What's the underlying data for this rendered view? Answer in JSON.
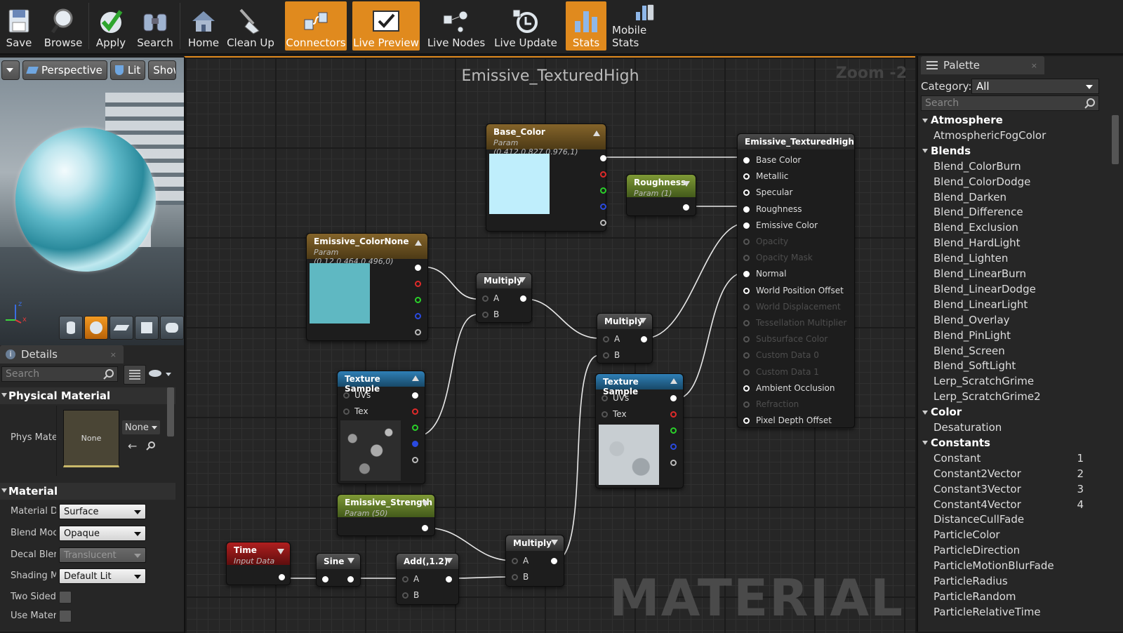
{
  "toolbar": {
    "save": "Save",
    "browse": "Browse",
    "apply": "Apply",
    "search": "Search",
    "home": "Home",
    "clean_up": "Clean Up",
    "connectors": "Connectors",
    "live_preview": "Live Preview",
    "live_nodes": "Live Nodes",
    "live_update": "Live Update",
    "stats": "Stats",
    "mobile_stats": "Mobile Stats"
  },
  "viewport": {
    "perspective": "Perspective",
    "lit": "Lit",
    "show": "Show",
    "axis_z": "z",
    "axis_x": "x"
  },
  "details": {
    "tab": "Details",
    "search_placeholder": "Search",
    "physical_material": {
      "heading": "Physical Material",
      "phys_label": "Phys Mate",
      "thumb_text": "None",
      "combo": "None"
    },
    "material": {
      "heading": "Material",
      "domain_label": "Material D",
      "domain_value": "Surface",
      "blend_label": "Blend Moc",
      "blend_value": "Opaque",
      "decal_label": "Decal Bler",
      "decal_value": "Translucent",
      "shading_label": "Shading M",
      "shading_value": "Default Lit",
      "two_sided_label": "Two Sided",
      "use_mat_label": "Use Mater"
    }
  },
  "graph": {
    "title": "Emissive_TexturedHigh",
    "zoom": "Zoom -2",
    "watermark": "MATERIAL",
    "nodes": {
      "base_color": {
        "title": "Base_Color",
        "sub": "Param (0.412,0.827,0.976,1)",
        "color": "#bfeefc"
      },
      "roughness": {
        "title": "Roughness",
        "sub": "Param (1)"
      },
      "emissive_color": {
        "title": "Emissive_ColorNone",
        "sub": "Param (0.12,0.464,0.496,0)",
        "color": "#5fb8c2"
      },
      "multiply1": {
        "title": "Multiply",
        "a": "A",
        "b": "B"
      },
      "multiply2": {
        "title": "Multiply",
        "a": "A",
        "b": "B"
      },
      "multiply3": {
        "title": "Multiply",
        "a": "A",
        "b": "B"
      },
      "tex1": {
        "title": "Texture Sample",
        "uvs": "UVs",
        "tex": "Tex"
      },
      "tex2": {
        "title": "Texture Sample",
        "uvs": "UVs",
        "tex": "Tex"
      },
      "emissive_strength": {
        "title": "Emissive_Strength",
        "sub": "Param (50)"
      },
      "time": {
        "title": "Time",
        "sub": "Input Data"
      },
      "sine": {
        "title": "Sine"
      },
      "add": {
        "title": "Add(,1.2)",
        "a": "A",
        "b": "B"
      },
      "result": {
        "title": "Emissive_TexturedHigh",
        "pins": [
          "Base Color",
          "Metallic",
          "Specular",
          "Roughness",
          "Emissive Color",
          "Opacity",
          "Opacity Mask",
          "Normal",
          "World Position Offset",
          "World Displacement",
          "Tessellation Multiplier",
          "Subsurface Color",
          "Custom Data 0",
          "Custom Data 1",
          "Ambient Occlusion",
          "Refraction",
          "Pixel Depth Offset"
        ]
      }
    }
  },
  "palette": {
    "tab": "Palette",
    "category_label": "Category:",
    "category_value": "All",
    "search_placeholder": "Search",
    "entries": [
      {
        "cat": "Atmosphere"
      },
      {
        "item": "AtmosphericFogColor"
      },
      {
        "cat": "Blends"
      },
      {
        "item": "Blend_ColorBurn"
      },
      {
        "item": "Blend_ColorDodge"
      },
      {
        "item": "Blend_Darken"
      },
      {
        "item": "Blend_Difference"
      },
      {
        "item": "Blend_Exclusion"
      },
      {
        "item": "Blend_HardLight"
      },
      {
        "item": "Blend_Lighten"
      },
      {
        "item": "Blend_LinearBurn"
      },
      {
        "item": "Blend_LinearDodge"
      },
      {
        "item": "Blend_LinearLight"
      },
      {
        "item": "Blend_Overlay"
      },
      {
        "item": "Blend_PinLight"
      },
      {
        "item": "Blend_Screen"
      },
      {
        "item": "Blend_SoftLight"
      },
      {
        "item": "Lerp_ScratchGrime"
      },
      {
        "item": "Lerp_ScratchGrime2"
      },
      {
        "cat": "Color"
      },
      {
        "item": "Desaturation"
      },
      {
        "cat": "Constants"
      },
      {
        "item": "Constant",
        "num": "1"
      },
      {
        "item": "Constant2Vector",
        "num": "2"
      },
      {
        "item": "Constant3Vector",
        "num": "3"
      },
      {
        "item": "Constant4Vector",
        "num": "4"
      },
      {
        "item": "DistanceCullFade"
      },
      {
        "item": "ParticleColor"
      },
      {
        "item": "ParticleDirection"
      },
      {
        "item": "ParticleMotionBlurFade"
      },
      {
        "item": "ParticleRadius"
      },
      {
        "item": "ParticleRandom"
      },
      {
        "item": "ParticleRelativeTime"
      }
    ]
  },
  "colors": {
    "accent": "#e08a1e",
    "graph_bg": "#262626"
  }
}
